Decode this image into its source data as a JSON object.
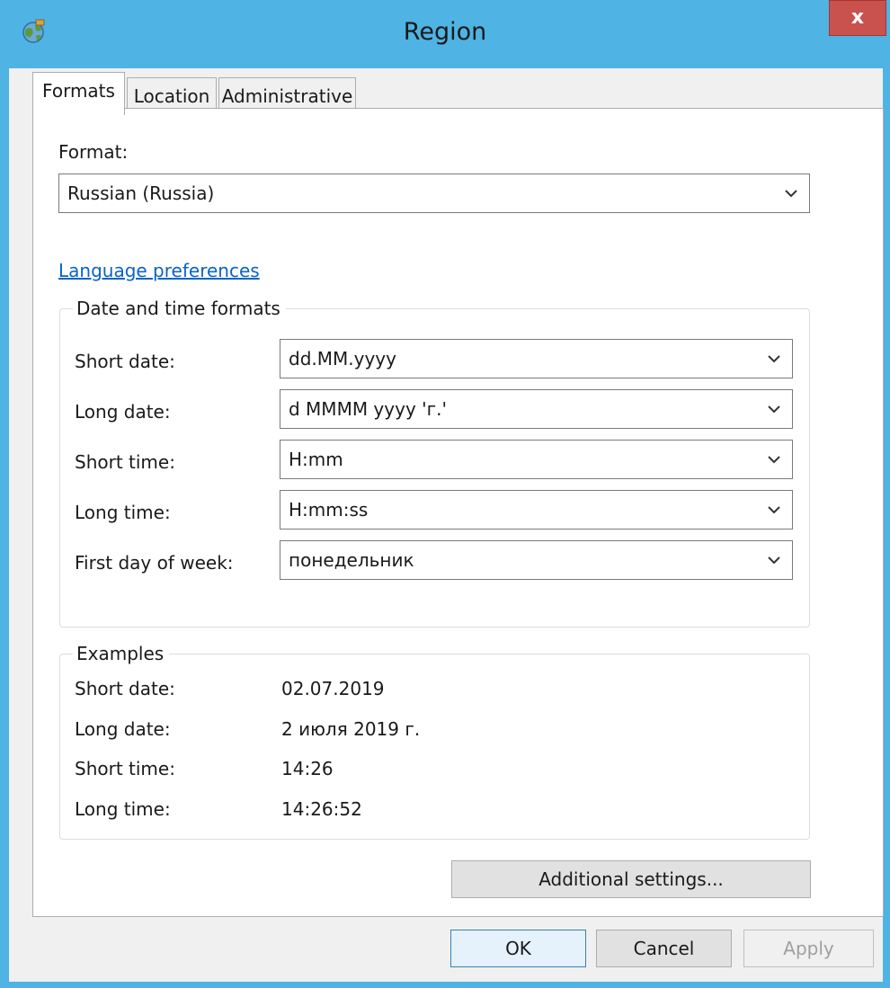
{
  "window": {
    "title": "Region",
    "close_label": "x"
  },
  "tabs": [
    {
      "label": "Formats",
      "active": true
    },
    {
      "label": "Location",
      "active": false
    },
    {
      "label": "Administrative",
      "active": false
    }
  ],
  "format": {
    "label": "Format:",
    "value": "Russian (Russia)"
  },
  "language_link": "Language preferences",
  "datetime": {
    "title": "Date and time formats",
    "rows": [
      {
        "label": "Short date:",
        "value": "dd.MM.yyyy"
      },
      {
        "label": "Long date:",
        "value": "d MMMM yyyy 'г.'"
      },
      {
        "label": "Short time:",
        "value": "H:mm"
      },
      {
        "label": "Long time:",
        "value": "H:mm:ss"
      },
      {
        "label": "First day of week:",
        "value": "понедельник"
      }
    ]
  },
  "examples": {
    "title": "Examples",
    "rows": [
      {
        "label": "Short date:",
        "value": "02.07.2019"
      },
      {
        "label": "Long date:",
        "value": "2 июля 2019 г."
      },
      {
        "label": "Short time:",
        "value": "14:26"
      },
      {
        "label": "Long time:",
        "value": "14:26:52"
      }
    ]
  },
  "buttons": {
    "additional": "Additional settings...",
    "ok": "OK",
    "cancel": "Cancel",
    "apply": "Apply",
    "apply_enabled": false
  },
  "icons": {
    "app": "globe-icon",
    "close": "close-icon",
    "dropdown": "chevron-down-icon"
  },
  "colors": {
    "frame": "#4fb3e3",
    "close": "#c9524f",
    "link": "#0a63c9"
  }
}
